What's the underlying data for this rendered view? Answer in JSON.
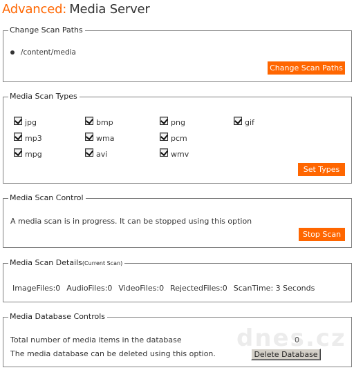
{
  "header": {
    "title_accent": "Advanced:",
    "title_rest": "Media Server"
  },
  "colors": {
    "accent": "#ff6600",
    "button_text": "#ffffff",
    "border": "#808080"
  },
  "scan_paths": {
    "legend": "Change Scan Paths",
    "paths": [
      "/content/media"
    ],
    "button_label": "Change Scan Paths"
  },
  "scan_types": {
    "legend": "Media Scan Types",
    "types": [
      {
        "label": "jpg",
        "checked": true
      },
      {
        "label": "bmp",
        "checked": true
      },
      {
        "label": "png",
        "checked": true
      },
      {
        "label": "gif",
        "checked": true
      },
      {
        "label": "mp3",
        "checked": true
      },
      {
        "label": "wma",
        "checked": true
      },
      {
        "label": "pcm",
        "checked": true
      },
      {
        "label": "mpg",
        "checked": true
      },
      {
        "label": "avi",
        "checked": true
      },
      {
        "label": "wmv",
        "checked": true
      }
    ],
    "button_label": "Set Types"
  },
  "scan_control": {
    "legend": "Media Scan Control",
    "message": "A media scan is in progress. It can be stopped using this option",
    "button_label": "Stop Scan"
  },
  "scan_details": {
    "legend": "Media Scan Details",
    "legend_suffix": "(Current Scan)",
    "image_files": "ImageFiles:0",
    "audio_files": "AudioFiles:0",
    "video_files": "VideoFiles:0",
    "rejected_files": "RejectedFiles:0",
    "scan_time": "ScanTime: 3 Seconds"
  },
  "database": {
    "legend": "Media Database Controls",
    "total_label": "Total number of media items in the database",
    "total_value": "0",
    "delete_message": "The media database can be deleted using this option.",
    "button_label": "Delete Database"
  },
  "watermark": "dnes.cz"
}
